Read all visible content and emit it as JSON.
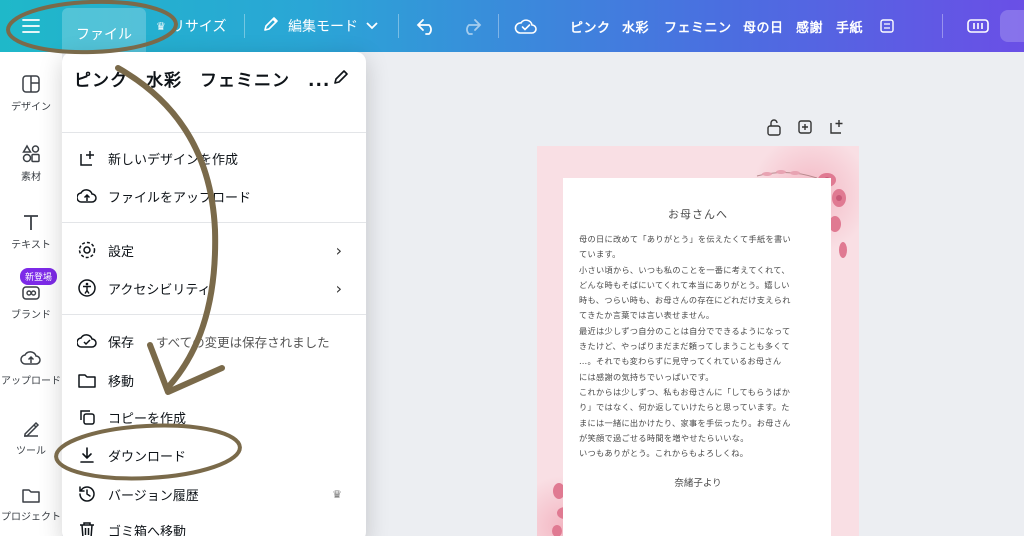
{
  "topbar": {
    "file": "ファイル",
    "resize": "リサイズ",
    "edit_mode": "編集モード",
    "tags": [
      "ピンク",
      "水彩",
      "フェミニン",
      "母の日",
      "感謝",
      "手紙"
    ]
  },
  "rail": [
    {
      "label": "デザイン",
      "icon": "design-icon"
    },
    {
      "label": "素材",
      "icon": "elements-icon"
    },
    {
      "label": "テキスト",
      "icon": "text-icon"
    },
    {
      "label": "ブランド",
      "icon": "brand-icon"
    },
    {
      "label": "アップロード",
      "icon": "upload-icon"
    },
    {
      "label": "ツール",
      "icon": "tools-icon"
    },
    {
      "label": "プロジェクト",
      "icon": "folder-icon"
    }
  ],
  "rail_badge": "新登場",
  "menu": {
    "title": "ピンク　水彩　フェミニン　...",
    "items": [
      {
        "label": "新しいデザインを作成",
        "icon": "new-design-icon"
      },
      {
        "label": "ファイルをアップロード",
        "icon": "upload-cloud-icon"
      },
      {
        "label": "設定",
        "icon": "gear-icon"
      },
      {
        "label": "アクセシビリティ",
        "icon": "accessibility-icon"
      },
      {
        "label": "保存",
        "icon": "cloud-check-icon",
        "sub": "すべての変更は保存されました"
      },
      {
        "label": "移動",
        "icon": "folder-icon"
      },
      {
        "label": "コピーを作成",
        "icon": "copy-icon"
      },
      {
        "label": "ダウンロード",
        "icon": "download-icon"
      },
      {
        "label": "バージョン履歴",
        "icon": "history-icon"
      },
      {
        "label": "ゴミ箱へ移動",
        "icon": "trash-icon"
      }
    ]
  },
  "letter": {
    "title": "お母さんへ",
    "lines": [
      "母の日に改めて「ありがとう」を伝えたくて手紙を書い",
      "ています。",
      "小さい頃から、いつも私のことを一番に考えてくれて、",
      "どんな時もそばにいてくれて本当にありがとう。嬉しい",
      "時も、つらい時も、お母さんの存在にどれだけ支えられ",
      "てきたか言葉では言い表せません。",
      "最近は少しずつ自分のことは自分でできるようになって",
      "きたけど、やっぱりまだまだ頼ってしまうことも多くて",
      "…。それでも変わらずに見守ってくれているお母さん",
      "には感謝の気持ちでいっぱいです。",
      "これからは少しずつ、私もお母さんに「してもらうばか",
      "り」ではなく、何か返していけたらと思っています。た",
      "まには一緒に出かけたり、家事を手伝ったり。お母さん",
      "が笑顔で過ごせる時間を増やせたらいいな。",
      "いつもありがとう。これからもよろしくね。"
    ],
    "sign": "奈緒子より"
  },
  "colors": {
    "accent": "#7d2ae8",
    "annotation": "#7a6a4a"
  }
}
